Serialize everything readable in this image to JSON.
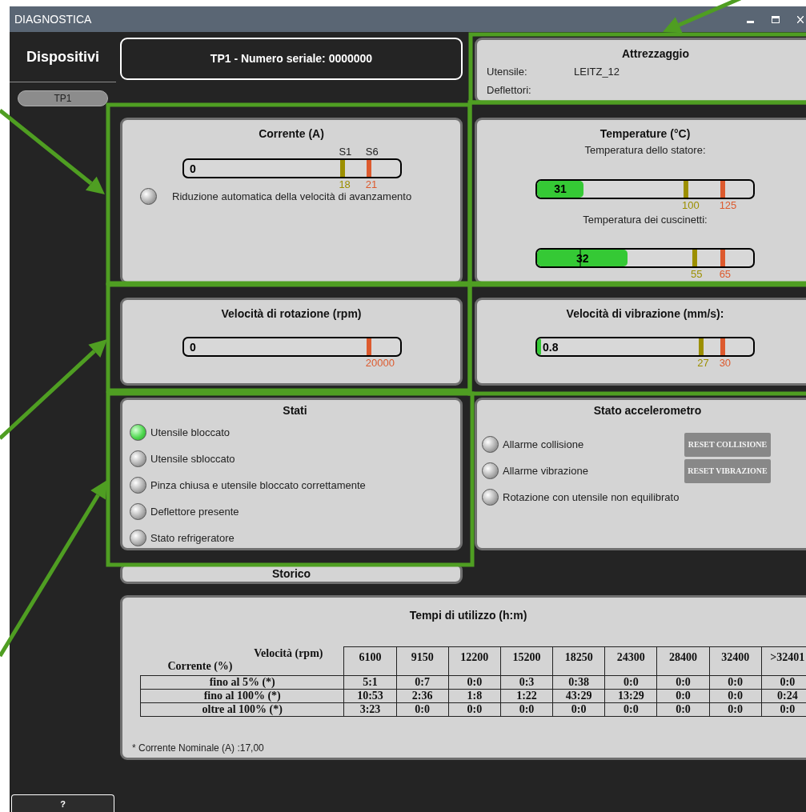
{
  "window": {
    "title": "DIAGNOSTICA"
  },
  "sidebar": {
    "title": "Dispositivi",
    "devices": [
      {
        "label": "TP1",
        "selected": true
      }
    ],
    "help_button": "?"
  },
  "device_header": "TP1 - Numero seriale: 0000000",
  "tooling": {
    "title": "Attrezzaggio",
    "fields": [
      {
        "label": "Utensile:",
        "value": "LEITZ_12"
      },
      {
        "label": "Deflettori:"
      }
    ]
  },
  "current": {
    "title": "Corrente (A)",
    "gauge": {
      "value": "0",
      "level": 0,
      "markers": [
        {
          "kind": "threshold",
          "level": 0.735,
          "color": "#9c8f00",
          "label": "18",
          "top_label": "S1"
        },
        {
          "kind": "threshold",
          "level": 0.857,
          "color": "#dd5a2e",
          "label": "21",
          "top_label": "S6"
        }
      ]
    },
    "indicator": {
      "label": "Riduzione automatica della velocità di avanzamento",
      "on": false
    }
  },
  "temperatures": {
    "title": "Temperature (°C)",
    "gauges": [
      {
        "caption": "Temperatura dello statore:",
        "value": "31",
        "level": 0.215,
        "markers": [
          {
            "kind": "threshold",
            "level": 0.69,
            "color": "#9c8f00",
            "label": "100"
          },
          {
            "kind": "threshold",
            "level": 0.86,
            "color": "#dd5a2e",
            "label": "125"
          }
        ]
      },
      {
        "caption": "Temperatura dei cuscinetti:",
        "value": "32",
        "level": 0.42,
        "markers": [
          {
            "kind": "needle",
            "level": 0.2,
            "color": "#1d5e1d"
          },
          {
            "kind": "threshold",
            "level": 0.73,
            "color": "#9c8f00",
            "label": "55"
          },
          {
            "kind": "threshold",
            "level": 0.86,
            "color": "#dd5a2e",
            "label": "65"
          }
        ]
      }
    ]
  },
  "rotation_speed": {
    "title": "Velocità di rotazione (rpm)",
    "gauge": {
      "value": "0",
      "level": 0,
      "markers": [
        {
          "kind": "threshold",
          "level": 0.857,
          "color": "#dd5a2e",
          "label": "20000"
        }
      ]
    }
  },
  "vibration_speed": {
    "title": "Velocità di vibrazione (mm/s):",
    "gauge": {
      "value": "0.8",
      "level": 0.02,
      "markers": [
        {
          "kind": "threshold",
          "level": 0.76,
          "color": "#9c8f00",
          "label": "27"
        },
        {
          "kind": "threshold",
          "level": 0.86,
          "color": "#dd5a2e",
          "label": "30"
        }
      ]
    }
  },
  "states": {
    "title": "Stati",
    "items": [
      {
        "label": "Utensile bloccato",
        "on": true
      },
      {
        "label": "Utensile sbloccato",
        "on": false
      },
      {
        "label": "Pinza chiusa e utensile bloccato correttamente",
        "on": false
      },
      {
        "label": "Deflettore presente",
        "on": false
      },
      {
        "label": "Stato refrigeratore",
        "on": false
      }
    ]
  },
  "accelerometer": {
    "title": "Stato accelerometro",
    "items": [
      {
        "label": "Allarme collisione",
        "on": false,
        "button": {
          "label": "RESET COLLISIONE",
          "disabled": true
        }
      },
      {
        "label": "Allarme vibrazione",
        "on": false,
        "button": {
          "label": "RESET VIBRAZIONE",
          "disabled": true
        }
      },
      {
        "label": "Rotazione con utensile non equilibrato",
        "on": false
      }
    ]
  },
  "history": {
    "title": "Storico"
  },
  "usage_times": {
    "title": "Tempi di utilizzo (h:m)",
    "row_header": "Velocità (rpm)",
    "column_header": "Corrente (%)",
    "columns": [
      "6100",
      "9150",
      "12200",
      "15200",
      "18250",
      "24300",
      "28400",
      "32400",
      ">32401"
    ],
    "rows": [
      {
        "label": "fino al 5% (*)",
        "cells": [
          "5:1",
          "0:7",
          "0:0",
          "0:3",
          "0:38",
          "0:0",
          "0:0",
          "0:0",
          "0:0"
        ]
      },
      {
        "label": "fino al 100% (*)",
        "cells": [
          "10:53",
          "2:36",
          "1:8",
          "1:22",
          "43:29",
          "13:29",
          "0:0",
          "0:0",
          "0:24"
        ]
      },
      {
        "label": "oltre al 100% (*)",
        "cells": [
          "3:23",
          "0:0",
          "0:0",
          "0:0",
          "0:0",
          "0:0",
          "0:0",
          "0:0",
          "0:0"
        ]
      }
    ],
    "footnote": "* Corrente Nominale (A) :17,00"
  }
}
